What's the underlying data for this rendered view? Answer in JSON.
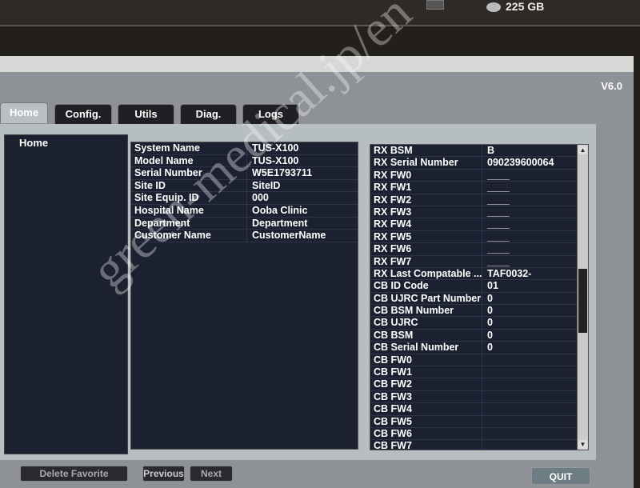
{
  "status": {
    "disk_free": "225 GB"
  },
  "version": "V6.0",
  "tabs": [
    {
      "label": "Home"
    },
    {
      "label": "Config."
    },
    {
      "label": "Utils"
    },
    {
      "label": "Diag."
    },
    {
      "label": "Logs"
    }
  ],
  "sidebar": {
    "items": [
      {
        "label": "Home"
      }
    ]
  },
  "system_info": [
    {
      "k": "System Name",
      "v": "TUS-X100"
    },
    {
      "k": "Model Name",
      "v": "TUS-X100"
    },
    {
      "k": "Serial Number",
      "v": "W5E1793711"
    },
    {
      "k": "Site ID",
      "v": "SiteID"
    },
    {
      "k": "Site Equip. ID",
      "v": "000"
    },
    {
      "k": "Hospital Name",
      "v": "Ooba Clinic"
    },
    {
      "k": "Department",
      "v": "Department"
    },
    {
      "k": "Customer Name",
      "v": "CustomerName"
    }
  ],
  "board_info": [
    {
      "k": "RX BSM",
      "v": "B"
    },
    {
      "k": "RX Serial Number",
      "v": "090239600064"
    },
    {
      "k": "RX FW0",
      "v": "____"
    },
    {
      "k": "RX FW1",
      "v": "____"
    },
    {
      "k": "RX FW2",
      "v": "____"
    },
    {
      "k": "RX FW3",
      "v": "____"
    },
    {
      "k": "RX FW4",
      "v": "____"
    },
    {
      "k": "RX FW5",
      "v": "____"
    },
    {
      "k": "RX FW6",
      "v": "____"
    },
    {
      "k": "RX FW7",
      "v": "____"
    },
    {
      "k": "RX Last Compatable ...",
      "v": "TAF0032-"
    },
    {
      "k": "CB ID Code",
      "v": "01"
    },
    {
      "k": "CB UJRC Part Number",
      "v": "0"
    },
    {
      "k": "CB BSM Number",
      "v": "0"
    },
    {
      "k": "CB UJRC",
      "v": "0"
    },
    {
      "k": "CB BSM",
      "v": "0"
    },
    {
      "k": "CB Serial Number",
      "v": "0"
    },
    {
      "k": "CB FW0",
      "v": ""
    },
    {
      "k": "CB FW1",
      "v": ""
    },
    {
      "k": "CB FW2",
      "v": ""
    },
    {
      "k": "CB FW3",
      "v": ""
    },
    {
      "k": "CB FW4",
      "v": ""
    },
    {
      "k": "CB FW5",
      "v": ""
    },
    {
      "k": "CB FW6",
      "v": ""
    },
    {
      "k": "CB FW7",
      "v": ""
    }
  ],
  "buttons": {
    "delete_favorite": "Delete Favorite",
    "previous": "Previous",
    "next": "Next",
    "quit": "QUIT"
  },
  "watermark": "green-medical.jp/en"
}
